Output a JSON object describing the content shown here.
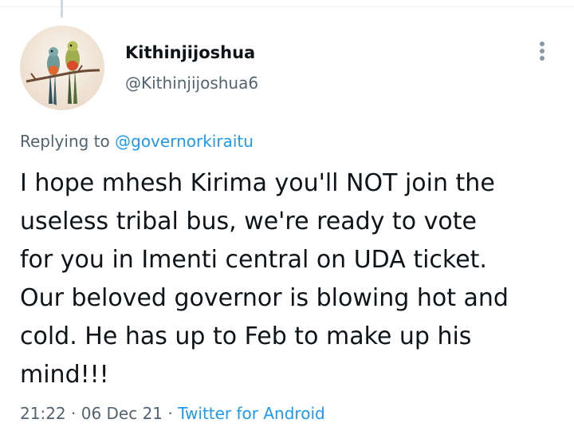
{
  "tweet": {
    "display_name": "Kithinjijoshua",
    "handle": "@Kithinjijoshua6",
    "replying_prefix": "Replying to",
    "replying_to": "@governorkiraitu",
    "body_lines": [
      "I hope mhesh Kirima you'll NOT join the",
      "useless tribal bus, we're ready to vote",
      "for you in Imenti central on UDA ticket.",
      "Our beloved governor is blowing hot and",
      "cold. He has up to Feb to make up his",
      "mind!!!"
    ],
    "time": "21:22",
    "date": "06 Dec 21",
    "separator": "·",
    "source": "Twitter for Android"
  },
  "icons": {
    "avatar": "avatar-birds-image",
    "more": "more-options-icon"
  },
  "colors": {
    "text_primary": "#0f1419",
    "text_secondary": "#536471",
    "link": "#1d9bf0",
    "divider": "#eff3f4"
  }
}
